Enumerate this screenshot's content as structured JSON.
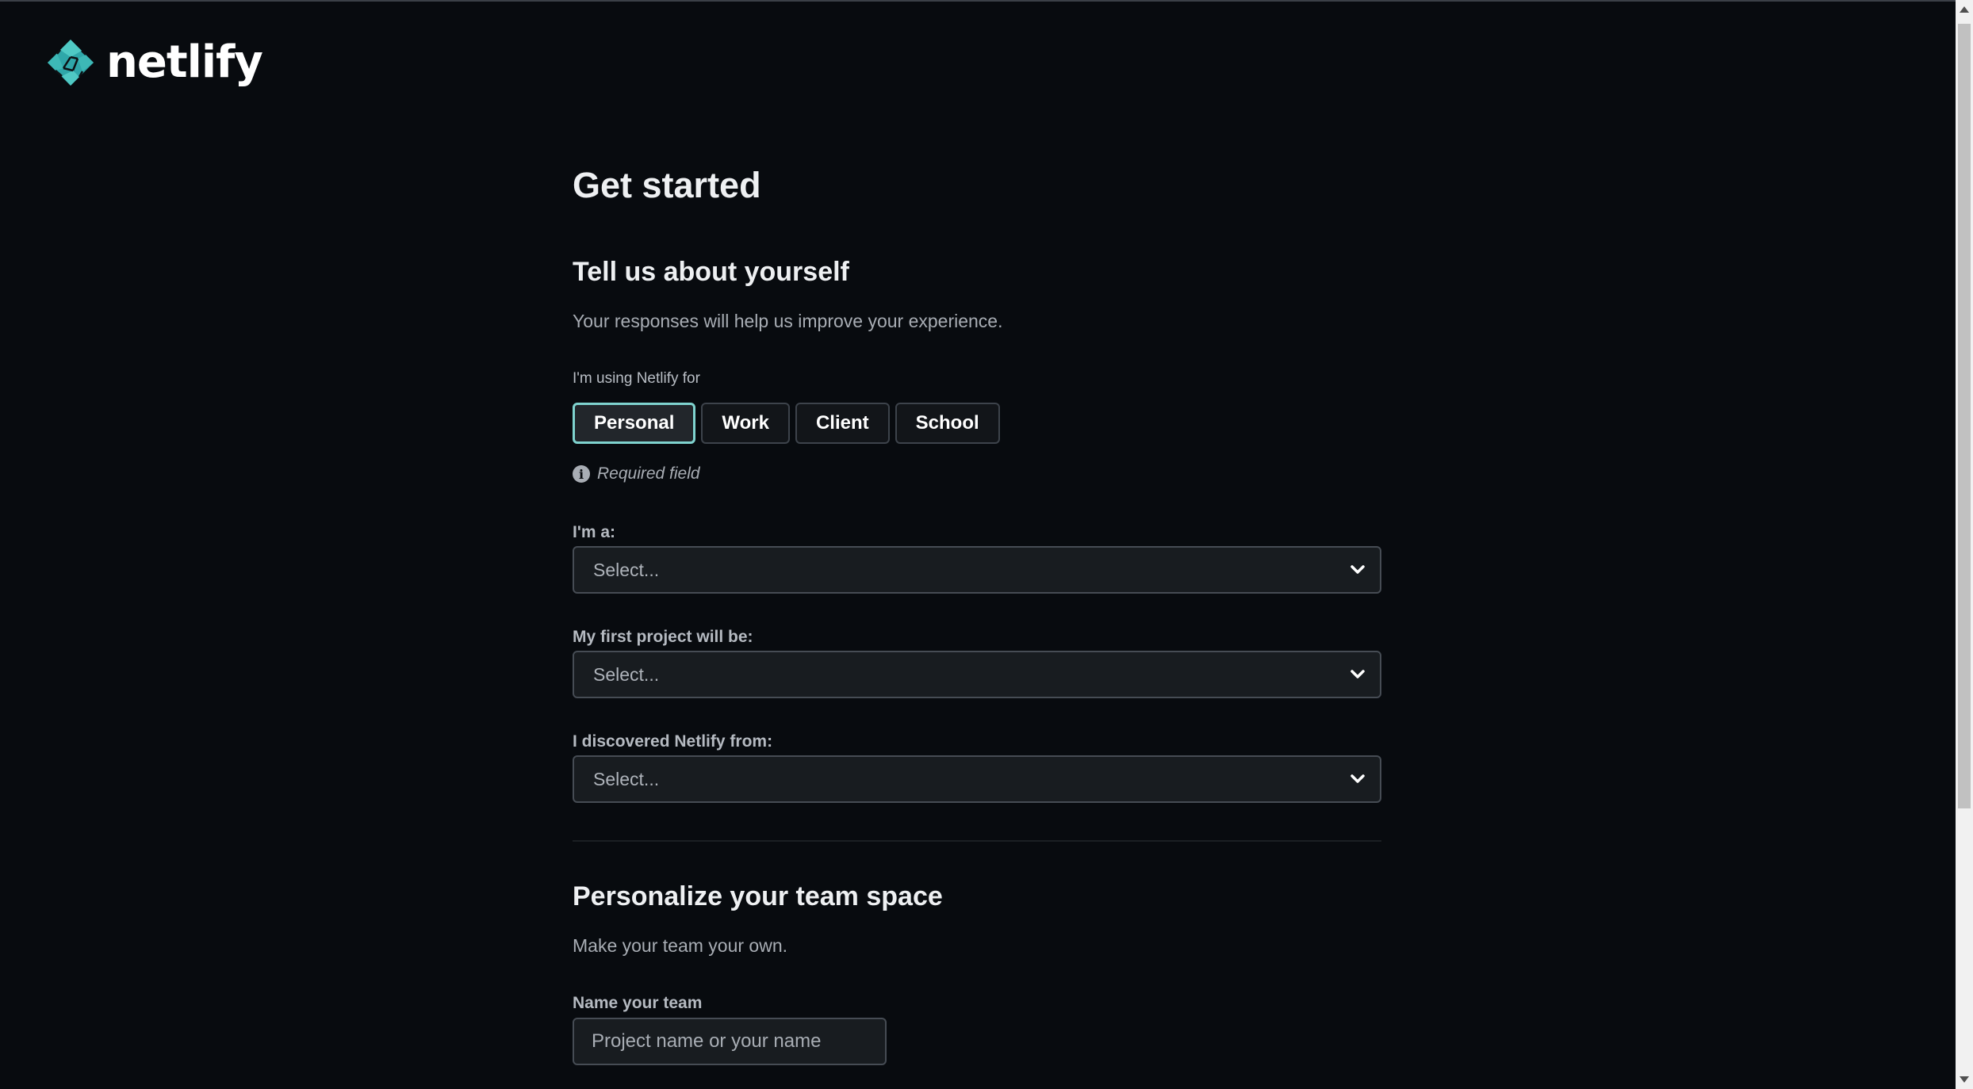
{
  "brand": {
    "name": "netlify",
    "colors": {
      "logo_primary": "#2fa7a9",
      "logo_secondary": "#4fc9c4"
    }
  },
  "page": {
    "title": "Get started"
  },
  "about_section": {
    "title": "Tell us about yourself",
    "description": "Your responses will help us improve your experience.",
    "usage_label": "I'm using Netlify for",
    "usage_options": [
      "Personal",
      "Work",
      "Client",
      "School"
    ],
    "selected_option": "Personal",
    "required_note": "Required field",
    "role_label": "I'm a:",
    "role_value": "Select...",
    "project_label": "My first project will be:",
    "project_value": "Select...",
    "source_label": "I discovered Netlify from:",
    "source_value": "Select..."
  },
  "team_section": {
    "title": "Personalize your team space",
    "description": "Make your team your own.",
    "team_name_label": "Name your team",
    "team_name_placeholder": "Project name or your name",
    "team_name_value": ""
  },
  "theme": {
    "background": "#080b0f",
    "accent": "#7fd3cf",
    "muted_text": "#a8adb4"
  }
}
